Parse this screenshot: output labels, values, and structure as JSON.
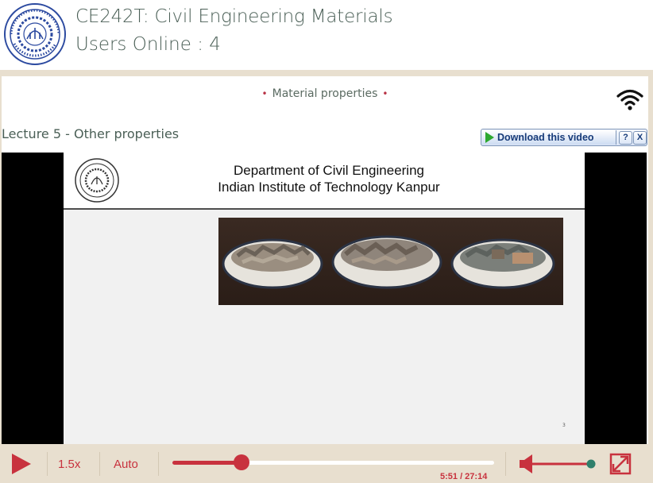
{
  "header": {
    "course_title": "CE242T: Civil Engineering Materials",
    "users_online": "Users Online : 4",
    "logo_icon": "iit-kanpur-seal-icon"
  },
  "chapter": {
    "title": "Material properties"
  },
  "lecture": {
    "title": "Lecture 5 - Other properties"
  },
  "download": {
    "label": "Download this video",
    "help": "?",
    "close": "X"
  },
  "slide": {
    "line1": "Department of Civil Engineering",
    "line2": "Indian Institute of Technology Kanpur",
    "page": "3"
  },
  "player": {
    "speed": "1.5x",
    "quality": "Auto",
    "time": "5:51 / 27:14",
    "progress": 0.215,
    "volume": 1.0
  },
  "colors": {
    "accent": "#c8323e",
    "header_text": "#4a5f56",
    "frame": "#e8dfcf",
    "download_text": "#173b79"
  }
}
